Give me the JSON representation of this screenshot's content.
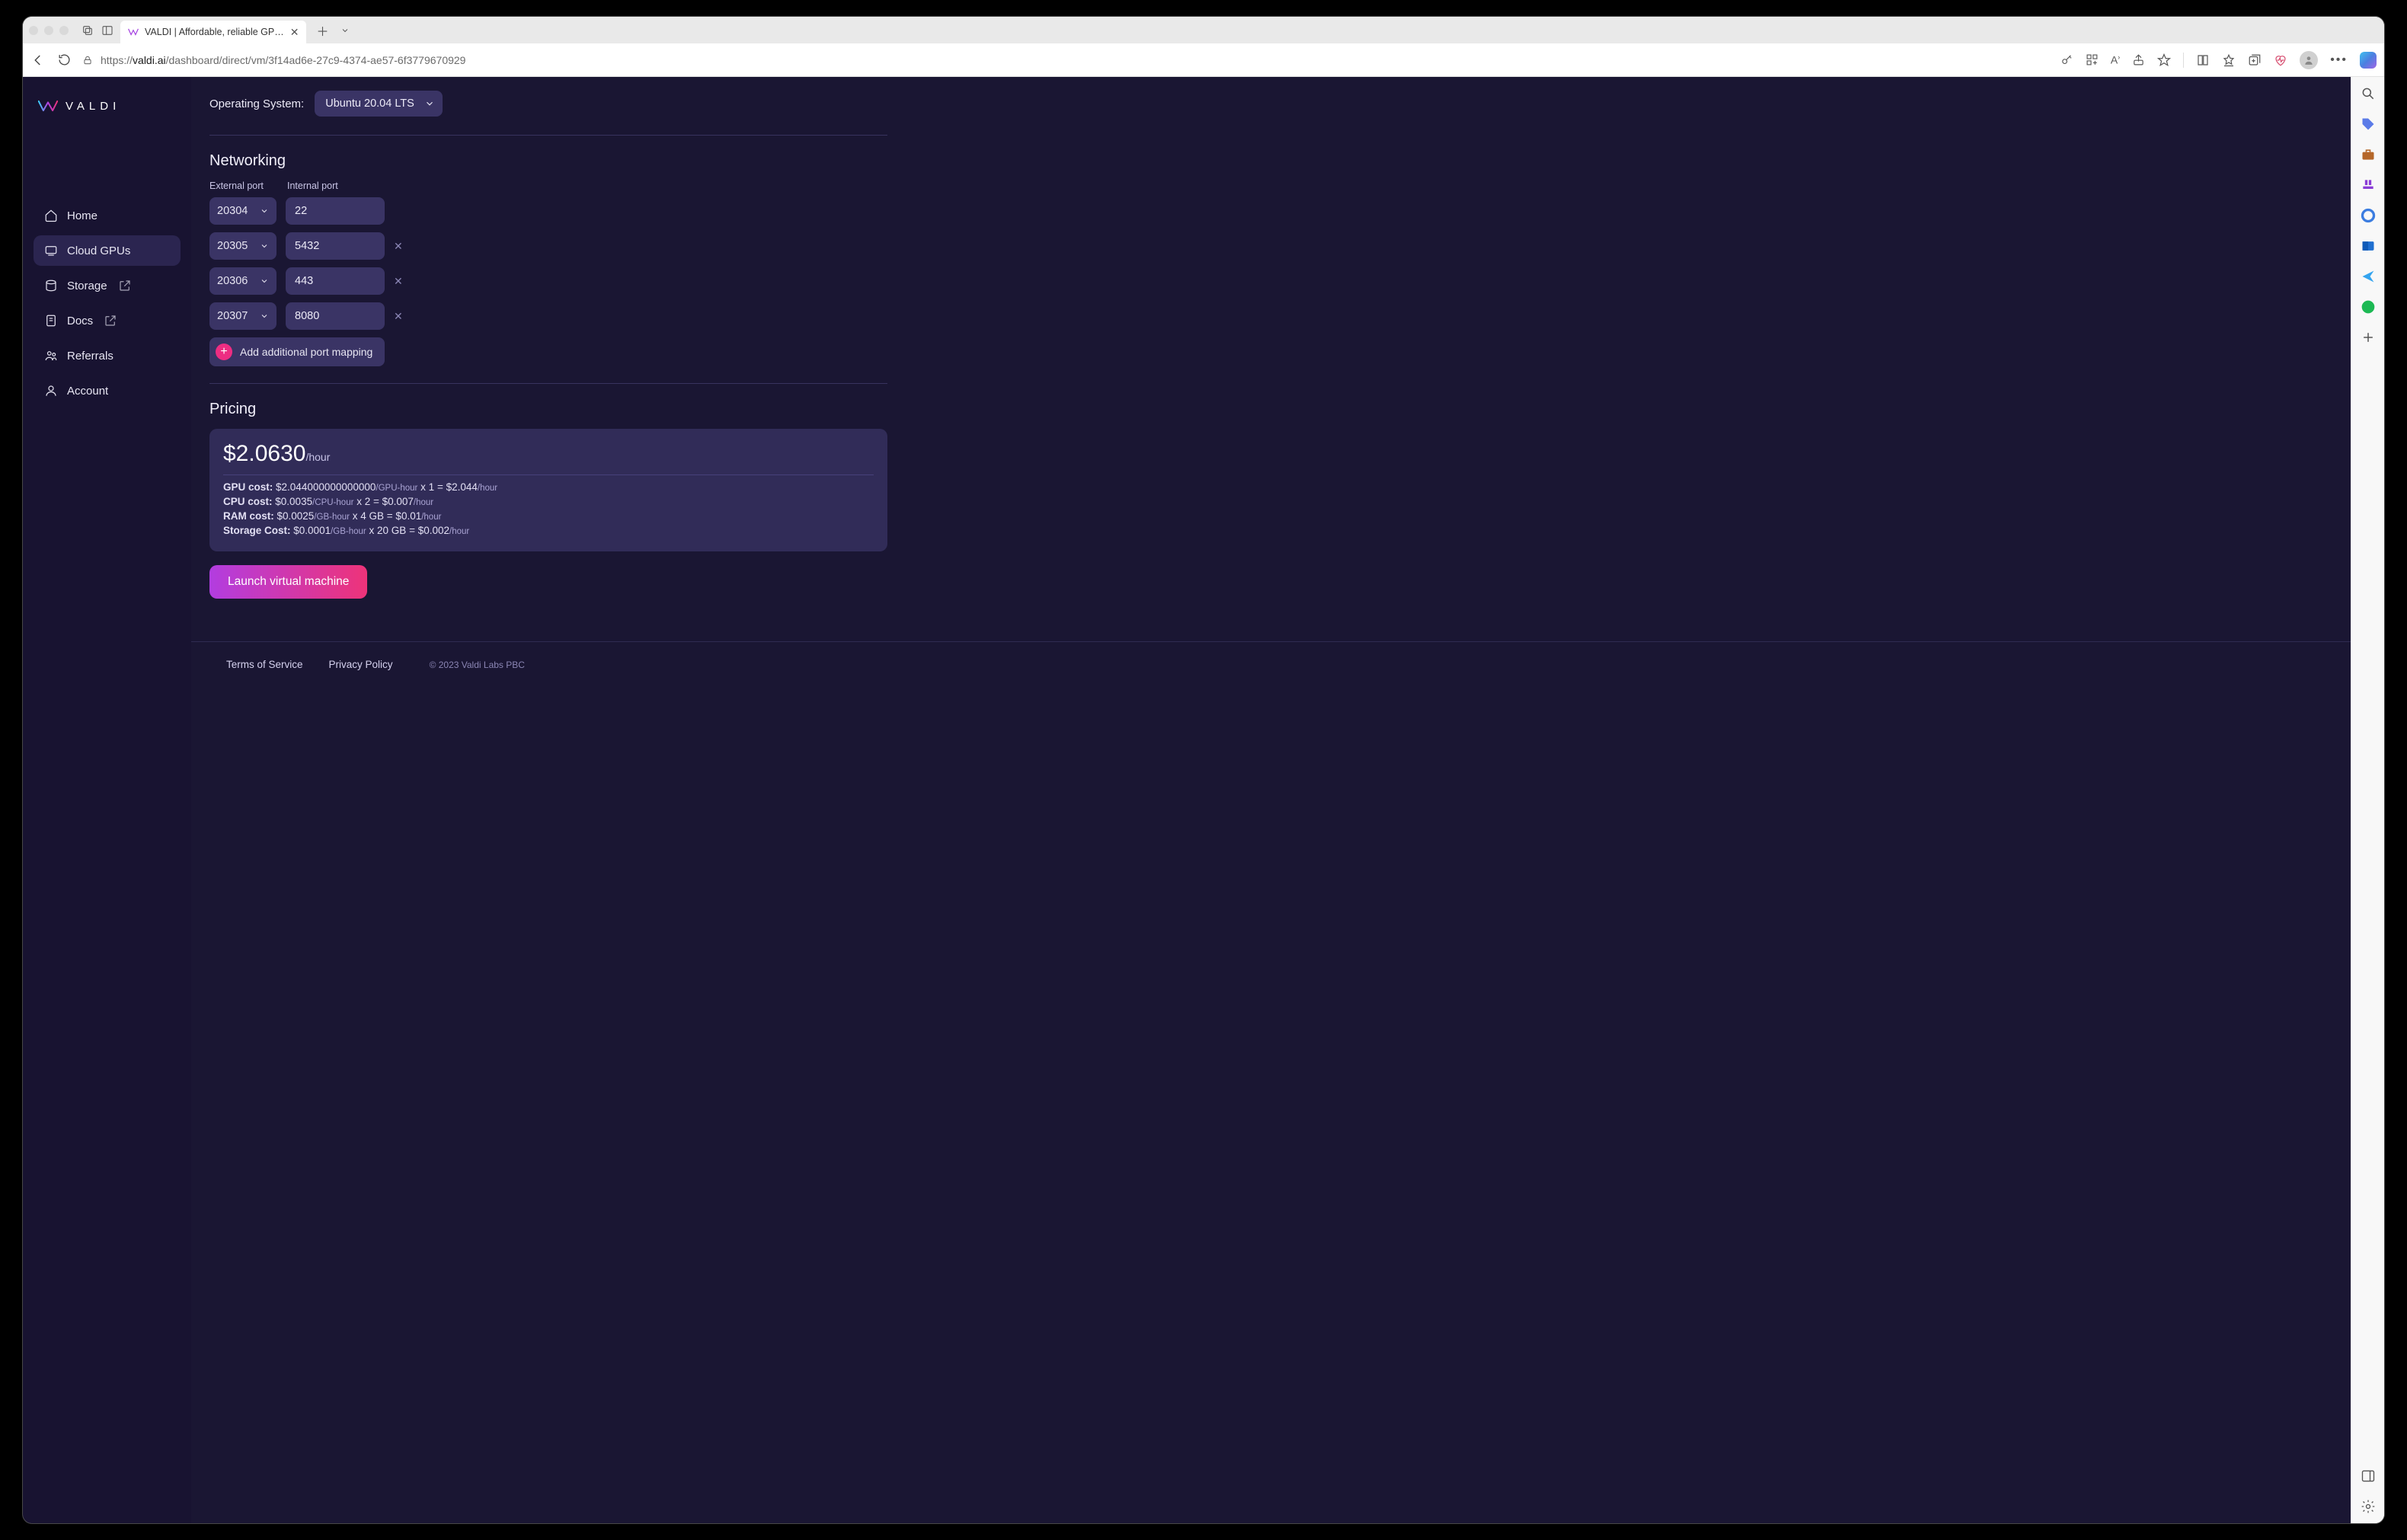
{
  "browser": {
    "tab_title": "VALDI | Affordable, reliable GP…",
    "url_prefix": "https://",
    "url_host": "valdi.ai",
    "url_path": "/dashboard/direct/vm/3f14ad6e-27c9-4374-ae57-6f3779670929"
  },
  "logo_text": "VALDI",
  "sidebar": {
    "items": [
      {
        "label": "Home",
        "icon": "home"
      },
      {
        "label": "Cloud GPUs",
        "icon": "gpu",
        "active": true
      },
      {
        "label": "Storage",
        "icon": "storage",
        "external": true
      },
      {
        "label": "Docs",
        "icon": "docs",
        "external": true
      },
      {
        "label": "Referrals",
        "icon": "referrals"
      },
      {
        "label": "Account",
        "icon": "account"
      }
    ]
  },
  "os": {
    "label": "Operating System:",
    "value": "Ubuntu 20.04 LTS"
  },
  "networking": {
    "title": "Networking",
    "ext_label": "External port",
    "int_label": "Internal port",
    "rows": [
      {
        "ext": "20304",
        "int": "22",
        "removable": false
      },
      {
        "ext": "20305",
        "int": "5432",
        "removable": true
      },
      {
        "ext": "20306",
        "int": "443",
        "removable": true
      },
      {
        "ext": "20307",
        "int": "8080",
        "removable": true
      }
    ],
    "add_label": "Add additional port mapping"
  },
  "pricing": {
    "title": "Pricing",
    "total_value": "$2.0630",
    "total_unit": "/hour",
    "lines": {
      "gpu": {
        "label": "GPU cost:",
        "rate": "$2.044000000000000",
        "rate_unit": "/GPU-hour",
        "qty": "x 1",
        "eq": "= $2.044",
        "eq_unit": "/hour"
      },
      "cpu": {
        "label": "CPU cost:",
        "rate": "$0.0035",
        "rate_unit": "/CPU-hour",
        "qty": "x 2",
        "eq": "= $0.007",
        "eq_unit": "/hour"
      },
      "ram": {
        "label": "RAM cost:",
        "rate": "$0.0025",
        "rate_unit": "/GB-hour",
        "qty": "x 4 GB",
        "eq": "= $0.01",
        "eq_unit": "/hour"
      },
      "stor": {
        "label": "Storage Cost:",
        "rate": "$0.0001",
        "rate_unit": "/GB-hour",
        "qty": "x 20 GB",
        "eq": "= $0.002",
        "eq_unit": "/hour"
      }
    }
  },
  "launch_label": "Launch virtual machine",
  "footer": {
    "tos": "Terms of Service",
    "privacy": "Privacy Policy",
    "copyright": "© 2023 Valdi Labs PBC"
  }
}
